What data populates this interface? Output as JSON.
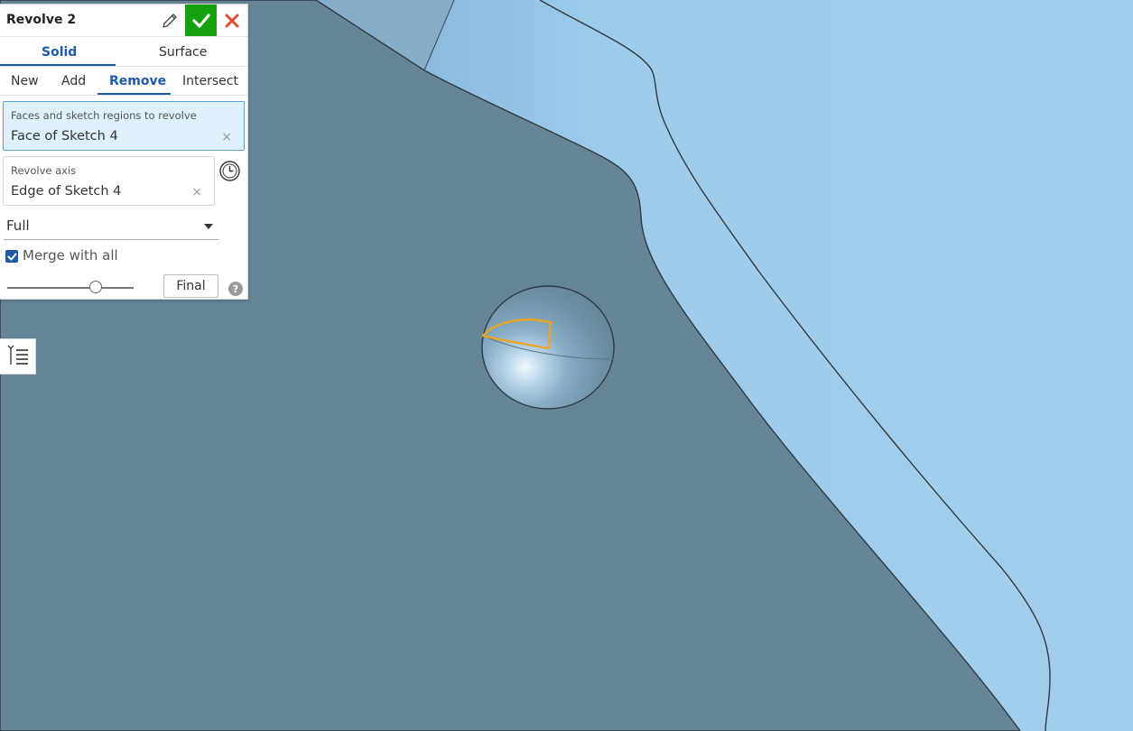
{
  "dialog": {
    "title": "Revolve 2",
    "type_tabs": [
      {
        "label": "Solid",
        "active": true
      },
      {
        "label": "Surface",
        "active": false
      }
    ],
    "operation_tabs": [
      {
        "label": "New",
        "active": false
      },
      {
        "label": "Add",
        "active": false
      },
      {
        "label": "Remove",
        "active": true
      },
      {
        "label": "Intersect",
        "active": false
      }
    ],
    "faces_field": {
      "label": "Faces and sketch regions to revolve",
      "value": "Face of Sketch 4",
      "clear": "×"
    },
    "axis_field": {
      "label": "Revolve axis",
      "value": "Edge of Sketch 4",
      "clear": "×"
    },
    "revolve_type": {
      "selected": "Full"
    },
    "merge": {
      "label": "Merge with all",
      "checked": true
    },
    "rollback_slider": {
      "value": 0.7
    },
    "final_label": "Final",
    "help_label": "?"
  },
  "icons": {
    "edit": "pencil-icon",
    "accept": "checkmark-icon",
    "cancel": "close-icon",
    "axis_option": "clock-icon",
    "feature_list": "list-icon"
  },
  "colors": {
    "accept": "#13a10e",
    "cancel": "#e0502a",
    "accent": "#1f5aa8",
    "part_top_face": "#668698",
    "part_side_face": "#9cc8e8",
    "sketch_highlight": "#f0a417"
  }
}
